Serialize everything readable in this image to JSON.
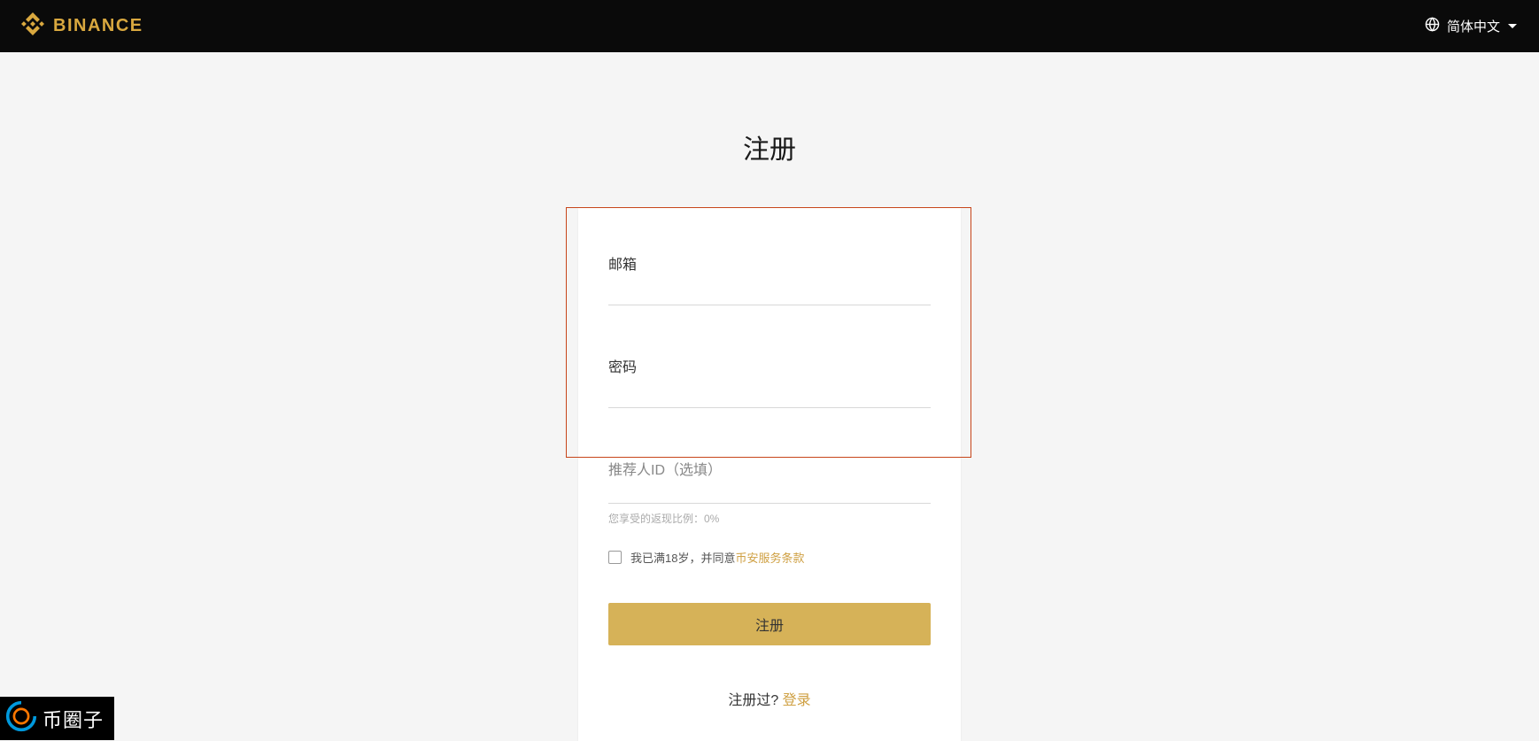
{
  "header": {
    "brand_name": "BINANCE",
    "language": "简体中文"
  },
  "page": {
    "title": "注册"
  },
  "form": {
    "email_label": "邮箱",
    "password_label": "密码",
    "referral_label": "推荐人ID（选填）",
    "rebate_text": "您享受的返现比例：0%",
    "agreement_text_prefix": "我已满18岁，并同意",
    "terms_link_text": "币安服务条款",
    "register_button": "注册",
    "login_prompt_prefix": "注册过? ",
    "login_link_text": "登录"
  },
  "watermark": {
    "text": "币圈子"
  }
}
